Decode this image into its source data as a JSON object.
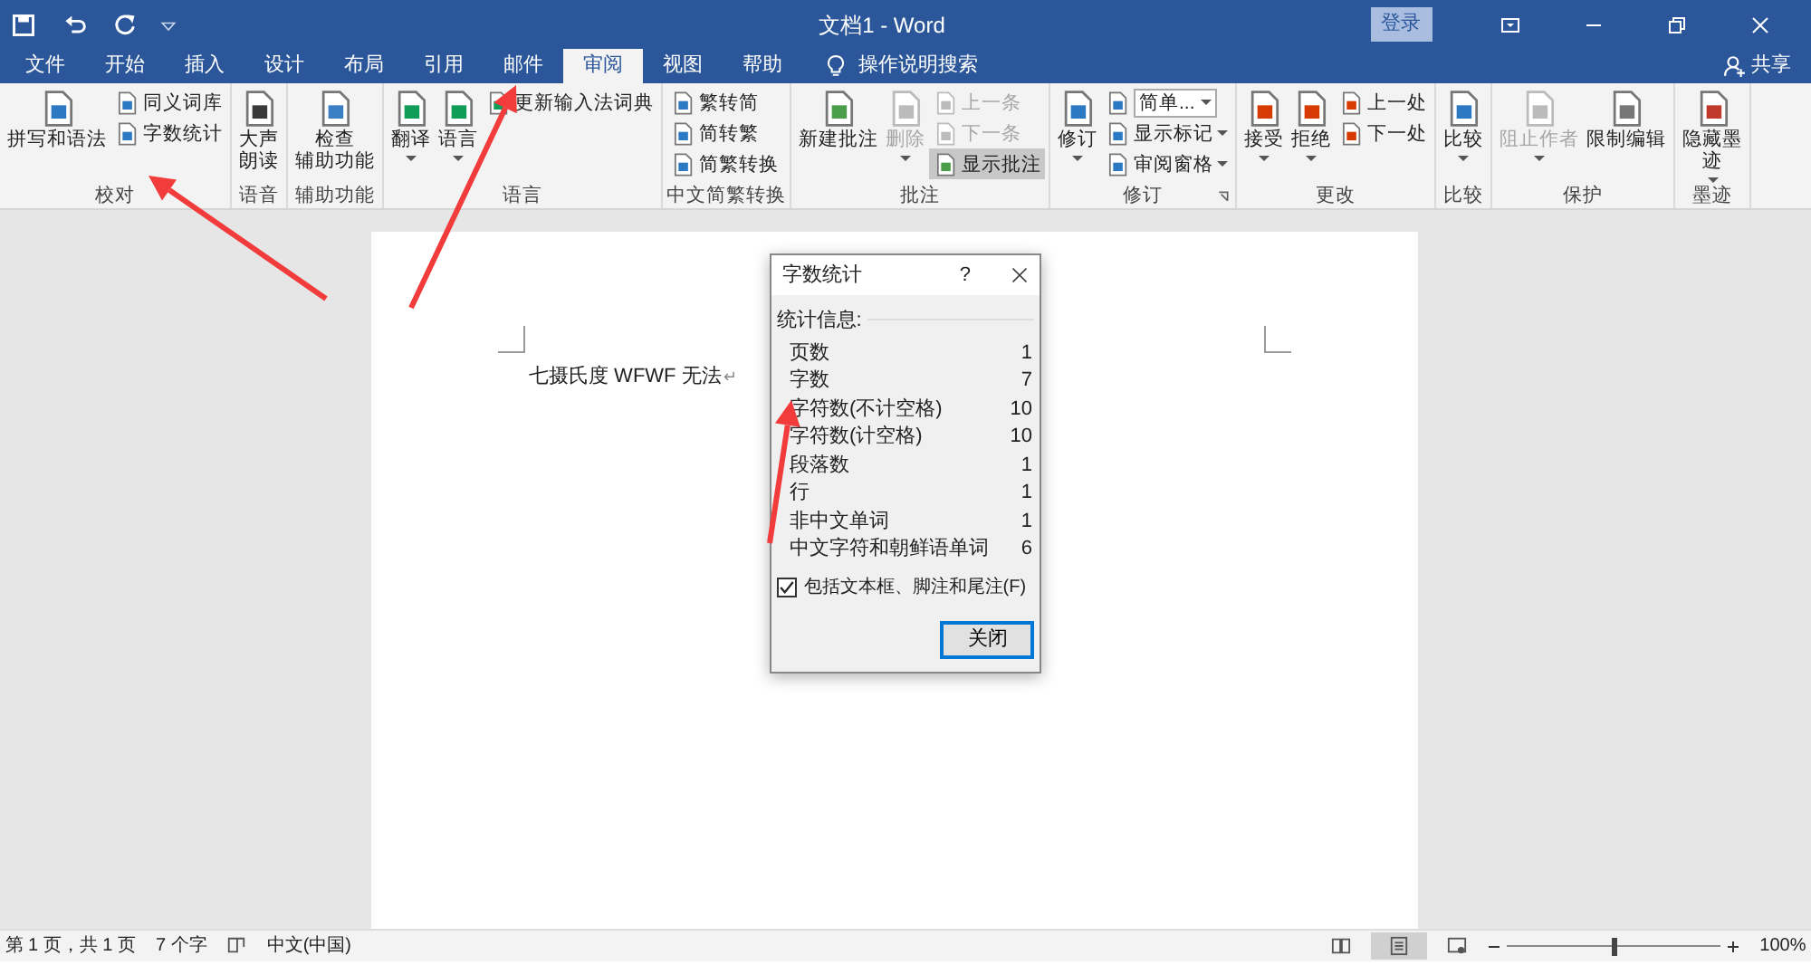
{
  "window": {
    "title": "文档1 - Word",
    "login": "登录",
    "share": "共享"
  },
  "tabs": [
    {
      "label": "文件",
      "selected": false
    },
    {
      "label": "开始",
      "selected": false
    },
    {
      "label": "插入",
      "selected": false
    },
    {
      "label": "设计",
      "selected": false
    },
    {
      "label": "布局",
      "selected": false
    },
    {
      "label": "引用",
      "selected": false
    },
    {
      "label": "邮件",
      "selected": false
    },
    {
      "label": "审阅",
      "selected": true
    },
    {
      "label": "视图",
      "selected": false
    },
    {
      "label": "帮助",
      "selected": false
    }
  ],
  "tell_me": "操作说明搜索",
  "ribbon": [
    {
      "label": "校对",
      "columns": [
        {
          "kind": "large",
          "lines": [
            "拼写和语法"
          ],
          "dropdown": false,
          "disabled": false
        },
        {
          "kind": "stack",
          "items": [
            {
              "kind": "button",
              "label": "同义词库",
              "disabled": false,
              "pressed": false,
              "dropdown": false
            },
            {
              "kind": "button",
              "label": "字数统计",
              "disabled": false,
              "pressed": false,
              "dropdown": false
            }
          ]
        }
      ]
    },
    {
      "label": "语音",
      "columns": [
        {
          "kind": "large",
          "lines": [
            "大声",
            "朗读"
          ],
          "dropdown": false,
          "disabled": false
        }
      ]
    },
    {
      "label": "辅助功能",
      "columns": [
        {
          "kind": "large",
          "lines": [
            "检查",
            "辅助功能"
          ],
          "dropdown": false,
          "disabled": false
        }
      ]
    },
    {
      "label": "语言",
      "columns": [
        {
          "kind": "large",
          "lines": [
            "翻译"
          ],
          "dropdown": true,
          "disabled": false
        },
        {
          "kind": "large",
          "lines": [
            "语言"
          ],
          "dropdown": true,
          "disabled": false
        },
        {
          "kind": "stack",
          "items": [
            {
              "kind": "button",
              "label": "更新输入法词典",
              "disabled": false,
              "pressed": false,
              "dropdown": false
            }
          ]
        }
      ]
    },
    {
      "label": "中文简繁转换",
      "columns": [
        {
          "kind": "stack",
          "items": [
            {
              "kind": "button",
              "label": "繁转简",
              "disabled": false,
              "pressed": false,
              "dropdown": false
            },
            {
              "kind": "button",
              "label": "简转繁",
              "disabled": false,
              "pressed": false,
              "dropdown": false
            },
            {
              "kind": "button",
              "label": "简繁转换",
              "disabled": false,
              "pressed": false,
              "dropdown": false
            }
          ]
        }
      ]
    },
    {
      "label": "批注",
      "columns": [
        {
          "kind": "large",
          "lines": [
            "新建批注"
          ],
          "dropdown": false,
          "disabled": false
        },
        {
          "kind": "large",
          "lines": [
            "删除"
          ],
          "dropdown": true,
          "disabled": true
        },
        {
          "kind": "stack",
          "items": [
            {
              "kind": "button",
              "label": "上一条",
              "disabled": true,
              "pressed": false,
              "dropdown": false
            },
            {
              "kind": "button",
              "label": "下一条",
              "disabled": true,
              "pressed": false,
              "dropdown": false
            },
            {
              "kind": "button",
              "label": "显示批注",
              "disabled": false,
              "pressed": true,
              "dropdown": false
            }
          ]
        }
      ]
    },
    {
      "label": "修订",
      "launcher": true,
      "columns": [
        {
          "kind": "large",
          "lines": [
            "修订"
          ],
          "dropdown": true,
          "disabled": false
        },
        {
          "kind": "stack",
          "items": [
            {
              "kind": "select",
              "label": "简单...",
              "disabled": false,
              "pressed": false,
              "dropdown": true
            },
            {
              "kind": "button",
              "label": "显示标记",
              "disabled": false,
              "pressed": false,
              "dropdown": true
            },
            {
              "kind": "button",
              "label": "审阅窗格",
              "disabled": false,
              "pressed": false,
              "dropdown": true
            }
          ]
        }
      ]
    },
    {
      "label": "更改",
      "columns": [
        {
          "kind": "large",
          "lines": [
            "接受"
          ],
          "dropdown": true,
          "disabled": false
        },
        {
          "kind": "large",
          "lines": [
            "拒绝"
          ],
          "dropdown": true,
          "disabled": false
        },
        {
          "kind": "stack",
          "items": [
            {
              "kind": "button",
              "label": "上一处",
              "disabled": false,
              "pressed": false,
              "dropdown": false
            },
            {
              "kind": "button",
              "label": "下一处",
              "disabled": false,
              "pressed": false,
              "dropdown": false
            }
          ]
        }
      ]
    },
    {
      "label": "比较",
      "columns": [
        {
          "kind": "large",
          "lines": [
            "比较"
          ],
          "dropdown": true,
          "disabled": false
        }
      ]
    },
    {
      "label": "保护",
      "columns": [
        {
          "kind": "large",
          "lines": [
            "阻止作者"
          ],
          "dropdown": true,
          "disabled": true
        },
        {
          "kind": "large",
          "lines": [
            "限制编辑"
          ],
          "dropdown": false,
          "disabled": false
        }
      ]
    },
    {
      "label": "墨迹",
      "columns": [
        {
          "kind": "large",
          "lines": [
            "隐藏墨",
            "迹"
          ],
          "dropdown": true,
          "disabled": false
        }
      ]
    }
  ],
  "document": {
    "text": "七摄氏度 WFWF 无法",
    "paragraph_mark": "↵"
  },
  "dialog": {
    "title": "字数统计",
    "help": "?",
    "section": "统计信息:",
    "rows": [
      {
        "label": "页数",
        "value": "1"
      },
      {
        "label": "字数",
        "value": "7"
      },
      {
        "label": "字符数(不计空格)",
        "value": "10"
      },
      {
        "label": "字符数(计空格)",
        "value": "10"
      },
      {
        "label": "段落数",
        "value": "1"
      },
      {
        "label": "行",
        "value": "1"
      },
      {
        "label": "非中文单词",
        "value": "1"
      },
      {
        "label": "中文字符和朝鲜语单词",
        "value": "6"
      }
    ],
    "checkbox": {
      "label": "包括文本框、脚注和尾注(F)",
      "checked": true
    },
    "button": "关闭"
  },
  "status_bar": {
    "page": "第 1 页，共 1 页",
    "words": "7 个字",
    "language": "中文(中国)",
    "zoom": {
      "level": 0.5
    },
    "zoom_text": "100%"
  }
}
